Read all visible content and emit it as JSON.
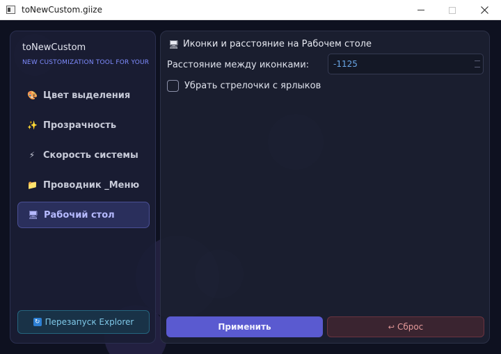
{
  "window": {
    "title": "toNewCustom.giize"
  },
  "sidebar": {
    "brand": "toNewCustom",
    "tagline": "NEW CUSTOMIZATION TOOL FOR YOUR",
    "items": [
      {
        "label": "Цвет выделения",
        "icon": "palette-icon",
        "glyph": "🎨"
      },
      {
        "label": "Прозрачность",
        "icon": "sparkles-icon",
        "glyph": "✨"
      },
      {
        "label": "Скорость системы",
        "icon": "lightning-icon",
        "glyph": "⚡"
      },
      {
        "label": "Проводник _Меню",
        "icon": "folder-icon",
        "glyph": "📁"
      },
      {
        "label": "Рабочий стол",
        "icon": "desktop-monitor-icon",
        "glyph": "🖥",
        "active": true
      }
    ],
    "restart_button": {
      "label": "Перезапуск Explorer",
      "icon": "refresh-icon",
      "glyph": "↻"
    }
  },
  "main": {
    "section_title": "Иконки и расстояние на Рабочем столе",
    "section_icon": "desktop-monitor-icon",
    "section_glyph": "🖥",
    "spacing_label": "Расстояние между иконками:",
    "spacing_value": "-1125",
    "arrows_checkbox_label": "Убрать стрелочки с ярлыков",
    "arrows_checkbox_checked": false,
    "apply_button": "Применить",
    "reset_button": "Сброс",
    "reset_glyph": "↩"
  },
  "colors": {
    "accent": "#5a5ad0",
    "active_nav": "#2a2f5c",
    "danger": "#6b3440",
    "info": "#24667f"
  }
}
